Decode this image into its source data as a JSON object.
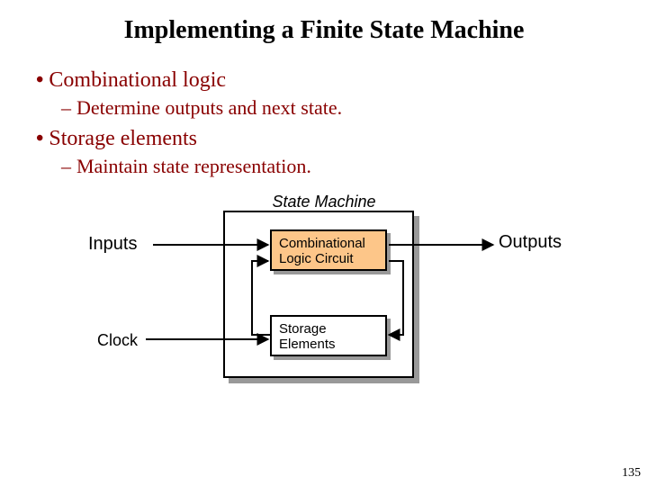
{
  "title": "Implementing a Finite State Machine",
  "bullets": {
    "b1": "Combinational logic",
    "b1sub": "Determine outputs and next state.",
    "b2": "Storage elements",
    "b2sub": "Maintain state representation."
  },
  "diagram": {
    "state_machine_label": "State Machine",
    "inputs_label": "Inputs",
    "outputs_label": "Outputs",
    "clock_label": "Clock",
    "clc_line1": "Combinational",
    "clc_line2": "Logic Circuit",
    "se_line1": "Storage",
    "se_line2": "Elements"
  },
  "page_number": "135"
}
